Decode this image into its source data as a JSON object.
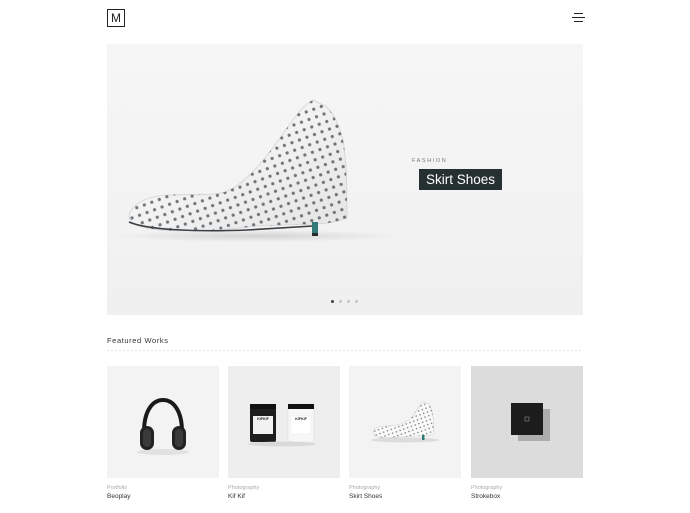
{
  "header": {
    "logo_text": "M",
    "menu_icon": "hamburger-menu-icon"
  },
  "hero": {
    "category": "FASHION",
    "title": "Skirt Shoes",
    "slides_total": 4,
    "active_slide": 1,
    "background": "#f3f3f3",
    "title_bg": "#263030"
  },
  "featured": {
    "heading": "Featured Works",
    "items": [
      {
        "category": "Portfolio",
        "title": "Beoplay",
        "bg": "#f3f3f3"
      },
      {
        "category": "Photography",
        "title": "Kif Kif",
        "bg": "#eeeeee"
      },
      {
        "category": "Photography",
        "title": "Skirt Shoes",
        "bg": "#f3f3f3"
      },
      {
        "category": "Photography",
        "title": "Strokebox",
        "bg": "#dcdcdc"
      }
    ]
  },
  "product_labels": {
    "jar_brand": "KIFKIF"
  }
}
